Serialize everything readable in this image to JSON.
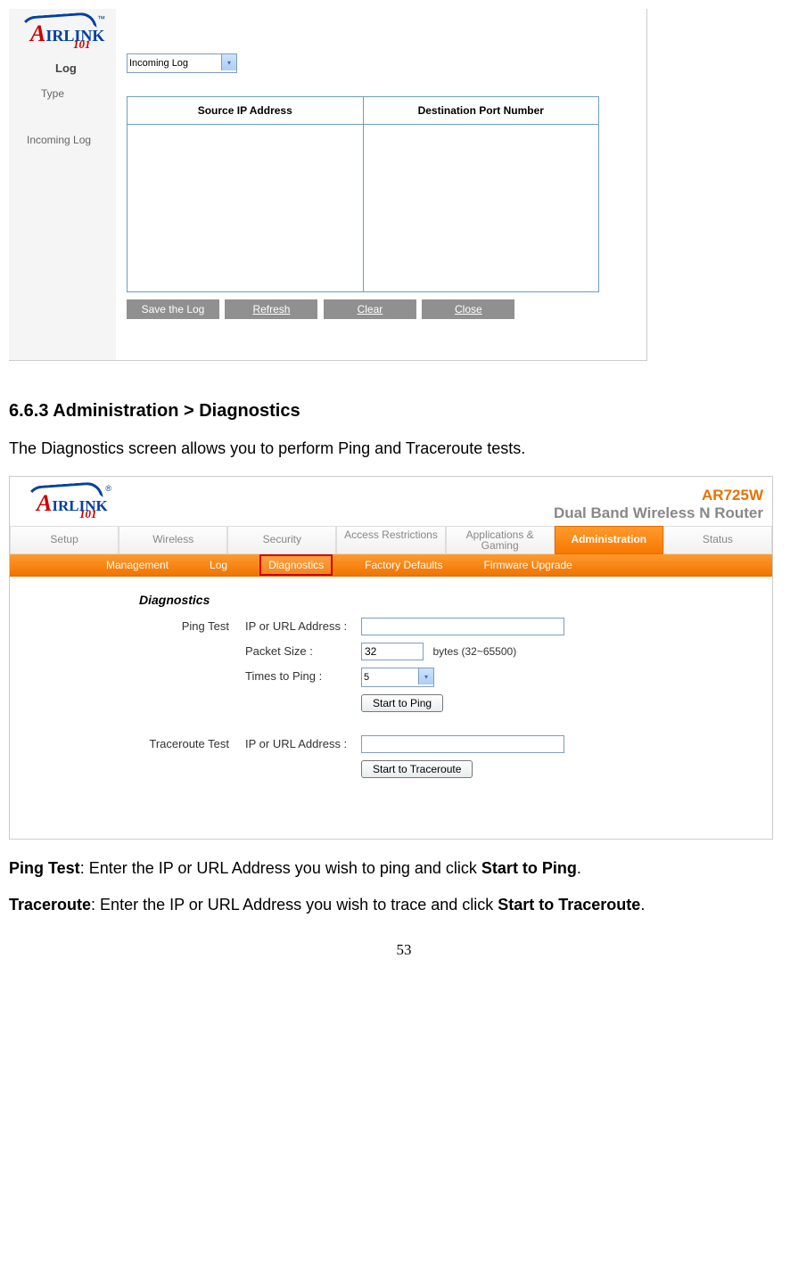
{
  "screenshot1": {
    "log_heading": "Log",
    "type_label": "Type",
    "type_value": "Incoming Log",
    "incoming_label": "Incoming Log",
    "col_source": "Source IP Address",
    "col_dest": "Destination Port Number",
    "buttons": {
      "save": "Save the Log",
      "refresh": "Refresh",
      "clear": "Clear",
      "close": "Close"
    }
  },
  "doc": {
    "heading": "6.6.3 Administration > Diagnostics",
    "intro": "The Diagnostics screen allows you to perform Ping and Traceroute tests.",
    "ping_b": "Ping Test",
    "ping_t": ": Enter the IP or URL Address you wish to ping and click ",
    "ping_b2": "Start to Ping",
    "tr_b": "Traceroute",
    "tr_t": ": Enter the IP or URL Address you wish to trace and click ",
    "tr_b2": "Start to Traceroute",
    "page": "53"
  },
  "screenshot2": {
    "product_code": "AR725W",
    "product_name": "Dual Band Wireless N Router",
    "tabs": [
      "Setup",
      "Wireless",
      "Security",
      "Access Restrictions",
      "Applications & Gaming",
      "Administration",
      "Status"
    ],
    "subtabs": [
      "Management",
      "Log",
      "Diagnostics",
      "Factory Defaults",
      "Firmware Upgrade"
    ],
    "diag_title": "Diagnostics",
    "ping_section": "Ping Test",
    "tr_section": "Traceroute Test",
    "ip_label": "IP or URL Address :",
    "pkt_label": "Packet Size :",
    "pkt_value": "32",
    "pkt_units": "bytes (32~65500)",
    "times_label": "Times to Ping :",
    "times_value": "5",
    "btn_ping": "Start to Ping",
    "btn_trace": "Start to Traceroute"
  }
}
